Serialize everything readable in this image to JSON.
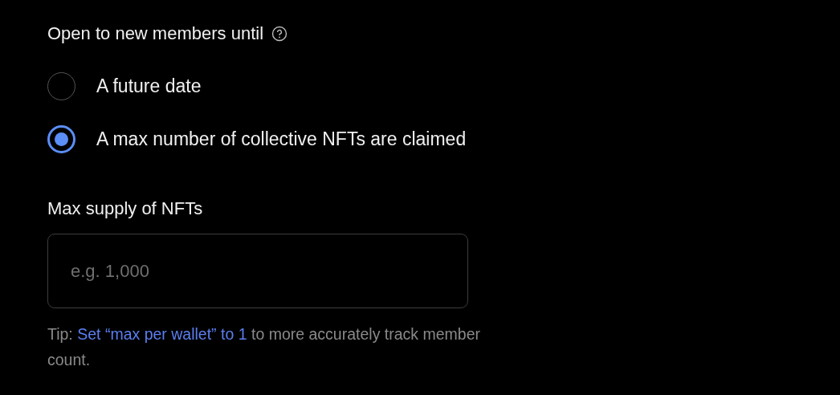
{
  "membership": {
    "label": "Open to new members until",
    "options": [
      {
        "label": "A future date",
        "selected": false
      },
      {
        "label": "A max number of collective NFTs are claimed",
        "selected": true
      }
    ]
  },
  "max_supply": {
    "label": "Max supply of NFTs",
    "placeholder": "e.g. 1,000",
    "tip": {
      "prefix": "Tip:",
      "link": "Set “max per wallet” to 1",
      "suffix": "to more accurately track member count."
    }
  }
}
